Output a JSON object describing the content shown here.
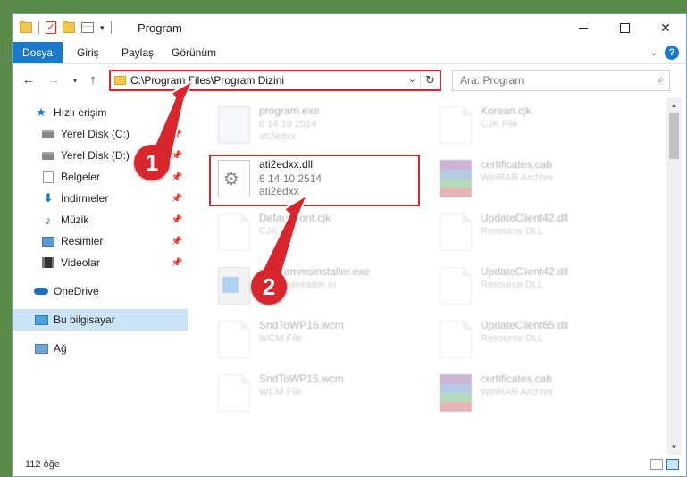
{
  "window": {
    "title": "Program"
  },
  "ribbon": {
    "tabs": [
      {
        "label": "Dosya",
        "active": true
      },
      {
        "label": "Giriş"
      },
      {
        "label": "Paylaş"
      },
      {
        "label": "Görünüm"
      }
    ],
    "help": "?"
  },
  "navbar": {
    "address": "C:\\Program Files\\Program Dizini",
    "search_placeholder": "Ara: Program"
  },
  "sidebar": {
    "items": [
      {
        "label": "Hızlı erişim",
        "icon": "star-icon",
        "pinned": false
      },
      {
        "label": "Yerel Disk (C:)",
        "icon": "disk-icon",
        "pinned": true
      },
      {
        "label": "Yerel Disk (D:)",
        "icon": "disk-icon",
        "pinned": true
      },
      {
        "label": "Belgeler",
        "icon": "documents-icon",
        "pinned": true
      },
      {
        "label": "İndirmeler",
        "icon": "download-icon",
        "pinned": true
      },
      {
        "label": "Müzik",
        "icon": "music-icon",
        "pinned": true
      },
      {
        "label": "Resimler",
        "icon": "pictures-icon",
        "pinned": true
      },
      {
        "label": "Videolar",
        "icon": "videos-icon",
        "pinned": true
      },
      {
        "label": "OneDrive",
        "icon": "cloud-icon"
      },
      {
        "label": "Bu bilgisayar",
        "icon": "computer-icon",
        "selected": true
      },
      {
        "label": "Ağ",
        "icon": "network-icon"
      }
    ]
  },
  "files": [
    {
      "name": "program.exe",
      "line2": "6 14 10 2514",
      "line3": "ati2edxx",
      "icon": "program-icon",
      "faded": true
    },
    {
      "name": "Korean.cjk",
      "line2": "CJK File",
      "line3": "",
      "icon": "document-icon",
      "faded": true
    },
    {
      "name": "ati2edxx.dll",
      "line2": "6 14 10 2514",
      "line3": "ati2edxx",
      "icon": "gear-file-icon",
      "faded": false
    },
    {
      "name": "certificates.cab",
      "line2": "WinRAR Archive",
      "line3": "",
      "icon": "winrar-icon",
      "faded": true
    },
    {
      "name": "DefaultFont.cjk",
      "line2": "CJK File",
      "line3": "",
      "icon": "document-icon",
      "faded": true
    },
    {
      "name": "UpdateClient42.dll",
      "line2": "Resource DLL",
      "line3": "",
      "icon": "document-icon",
      "faded": true
    },
    {
      "name": "programmsinstaller.exe",
      "line2": "Fitz fonereader In",
      "line3": "",
      "icon": "installer-icon",
      "faded": true
    },
    {
      "name": "UpdateClient42.dll",
      "line2": "Resource DLL",
      "line3": "",
      "icon": "document-icon",
      "faded": true
    },
    {
      "name": "SndToWP16.wcm",
      "line2": "WCM File",
      "line3": "",
      "icon": "document-icon",
      "faded": true
    },
    {
      "name": "UpdateClient65.dll",
      "line2": "Resource DLL",
      "line3": "",
      "icon": "document-icon",
      "faded": true
    },
    {
      "name": "SndToWP15.wcm",
      "line2": "WCM File",
      "line3": "",
      "icon": "document-icon",
      "faded": true
    },
    {
      "name": "certificates.cab",
      "line2": "WinRAR Archive",
      "line3": "",
      "icon": "winrar-icon",
      "faded": true
    }
  ],
  "status": {
    "count": "112 öğe"
  },
  "callouts": [
    {
      "label": "1"
    },
    {
      "label": "2"
    }
  ],
  "colors": {
    "accent": "#1979ca",
    "highlight": "#d9262d"
  }
}
